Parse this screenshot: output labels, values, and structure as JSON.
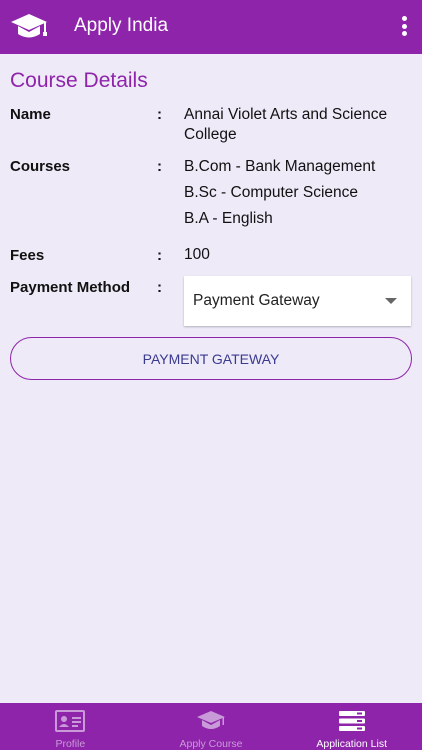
{
  "app": {
    "title": "Apply India",
    "logo_icon": "graduation-cap-icon",
    "menu_icon": "more-vert-icon"
  },
  "section": {
    "title": "Course Details"
  },
  "details": {
    "name_label": "Name",
    "name_value_line1": "Annai Violet Arts and Science",
    "name_value_line2": "College",
    "courses_label": "Courses",
    "courses": [
      "B.Com - Bank Management",
      "B.Sc - Computer Science",
      "B.A - English"
    ],
    "fees_label": "Fees",
    "fees_value": "100",
    "payment_label": "Payment Method",
    "colon": ":"
  },
  "payment_select": {
    "selected": "Payment Gateway"
  },
  "payment_button": {
    "label": "PAYMENT GATEWAY"
  },
  "bottom_nav": {
    "items": [
      {
        "label": "Profile",
        "icon": "id-card-icon",
        "active": false
      },
      {
        "label": "Apply Course",
        "icon": "graduation-cap-icon",
        "active": false
      },
      {
        "label": "Application List",
        "icon": "list-icon",
        "active": true
      }
    ]
  },
  "colors": {
    "primary": "#8e24aa",
    "background": "#eeeaf8",
    "button_text": "#3a3a8f"
  }
}
